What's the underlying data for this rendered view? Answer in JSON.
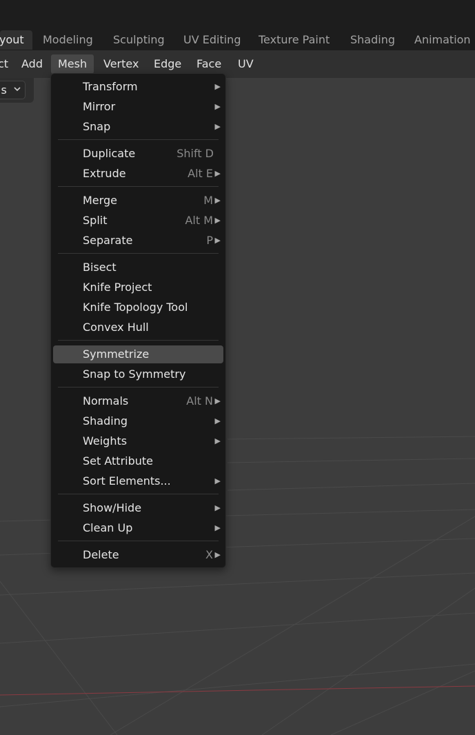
{
  "workspace_tabs": [
    {
      "label": "yout",
      "active": true
    },
    {
      "label": "Modeling",
      "active": false
    },
    {
      "label": "Sculpting",
      "active": false
    },
    {
      "label": "UV Editing",
      "active": false
    },
    {
      "label": "Texture Paint",
      "active": false
    },
    {
      "label": "Shading",
      "active": false
    },
    {
      "label": "Animation",
      "active": false
    }
  ],
  "header_menus": [
    "ct",
    "Add",
    "Mesh",
    "Vertex",
    "Edge",
    "Face",
    "UV"
  ],
  "mode_dropdown": {
    "label": "ıs"
  },
  "mesh_menu": {
    "items": [
      {
        "label": "Transform",
        "shortcut": "",
        "submenu": true
      },
      {
        "label": "Mirror",
        "shortcut": "",
        "submenu": true
      },
      {
        "label": "Snap",
        "shortcut": "",
        "submenu": true
      },
      {
        "label": "Duplicate",
        "shortcut": "Shift D",
        "submenu": false
      },
      {
        "label": "Extrude",
        "shortcut": "Alt E",
        "submenu": true
      },
      {
        "label": "Merge",
        "shortcut": "M",
        "submenu": true
      },
      {
        "label": "Split",
        "shortcut": "Alt M",
        "submenu": true
      },
      {
        "label": "Separate",
        "shortcut": "P",
        "submenu": true
      },
      {
        "label": "Bisect",
        "shortcut": "",
        "submenu": false
      },
      {
        "label": "Knife Project",
        "shortcut": "",
        "submenu": false
      },
      {
        "label": "Knife Topology Tool",
        "shortcut": "",
        "submenu": false
      },
      {
        "label": "Convex Hull",
        "shortcut": "",
        "submenu": false
      },
      {
        "label": "Symmetrize",
        "shortcut": "",
        "submenu": false,
        "highlighted": true
      },
      {
        "label": "Snap to Symmetry",
        "shortcut": "",
        "submenu": false
      },
      {
        "label": "Normals",
        "shortcut": "Alt N",
        "submenu": true
      },
      {
        "label": "Shading",
        "shortcut": "",
        "submenu": true
      },
      {
        "label": "Weights",
        "shortcut": "",
        "submenu": true
      },
      {
        "label": "Set Attribute",
        "shortcut": "",
        "submenu": false
      },
      {
        "label": "Sort Elements...",
        "shortcut": "",
        "submenu": true
      },
      {
        "label": "Show/Hide",
        "shortcut": "",
        "submenu": true
      },
      {
        "label": "Clean Up",
        "shortcut": "",
        "submenu": true
      },
      {
        "label": "Delete",
        "shortcut": "X",
        "submenu": true
      }
    ]
  },
  "colors": {
    "background": "#3d3d3d",
    "menu_bg": "#181818",
    "highlight": "#4a4a4a",
    "x_axis": "#8c3a42"
  }
}
